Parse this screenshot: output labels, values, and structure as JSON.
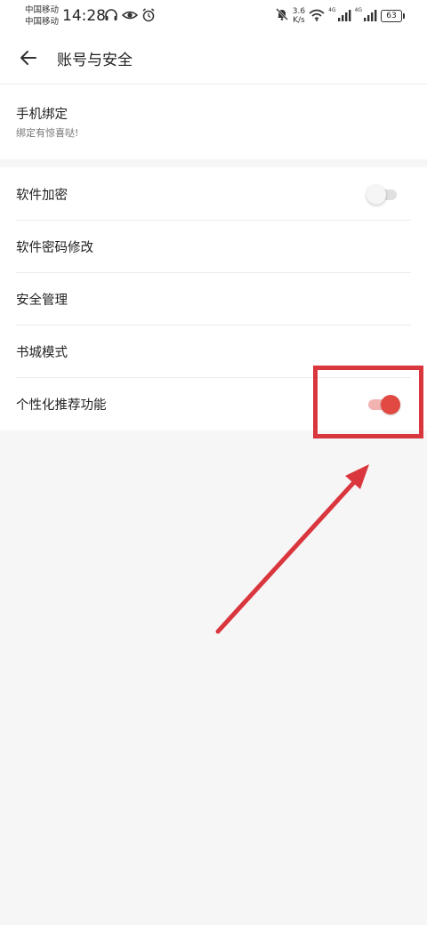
{
  "status_bar": {
    "carrier_1": "中国移动",
    "carrier_2": "中国移动",
    "time": "14:28",
    "net_speed_value": "3.6",
    "net_speed_unit": "K/s",
    "network_1": "4G",
    "network_2": "4G",
    "battery": "63"
  },
  "app_bar": {
    "title": "账号与安全"
  },
  "phone_binding": {
    "title": "手机绑定",
    "subtitle": "绑定有惊喜哒!"
  },
  "settings": [
    {
      "label": "软件加密",
      "toggle": false
    },
    {
      "label": "软件密码修改"
    },
    {
      "label": "安全管理"
    },
    {
      "label": "书城模式"
    },
    {
      "label": "个性化推荐功能",
      "toggle": true
    }
  ],
  "colors": {
    "accent": "#e04a42",
    "annotation": "#d9363e"
  }
}
